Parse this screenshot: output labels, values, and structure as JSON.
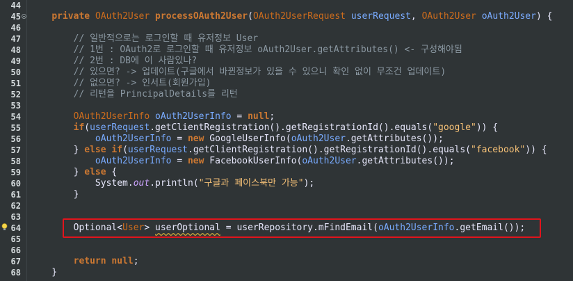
{
  "editor": {
    "lines": [
      {
        "num": "44",
        "tokens": []
      },
      {
        "num": "45",
        "tokens": [
          {
            "t": "    ",
            "c": "pl"
          },
          {
            "t": "private",
            "c": "kw"
          },
          {
            "t": " ",
            "c": "pl"
          },
          {
            "t": "OAuth2User",
            "c": "kw2"
          },
          {
            "t": " ",
            "c": "pl"
          },
          {
            "t": "processOAuth2User",
            "c": "kw"
          },
          {
            "t": "(",
            "c": "pl"
          },
          {
            "t": "OAuth2UserRequest",
            "c": "kw2"
          },
          {
            "t": " ",
            "c": "pl"
          },
          {
            "t": "userRequest",
            "c": "var"
          },
          {
            "t": ", ",
            "c": "pl"
          },
          {
            "t": "OAuth2User",
            "c": "kw2"
          },
          {
            "t": " ",
            "c": "pl"
          },
          {
            "t": "oAuth2User",
            "c": "var"
          },
          {
            "t": ") {",
            "c": "pl"
          }
        ]
      },
      {
        "num": "46",
        "tokens": []
      },
      {
        "num": "47",
        "tokens": [
          {
            "t": "        // 일반적으로는 로그인할 때 유저정보 User",
            "c": "cm"
          }
        ]
      },
      {
        "num": "48",
        "tokens": [
          {
            "t": "        // 1번 : OAuth2로 로그인할 때 유저정보 oAuth2User.getAttributes() <- 구성해야됨",
            "c": "cm"
          }
        ]
      },
      {
        "num": "49",
        "tokens": [
          {
            "t": "        // 2번 : DB에 이 사람있나?",
            "c": "cm"
          }
        ]
      },
      {
        "num": "50",
        "tokens": [
          {
            "t": "        // 있으면? -> 업데이트(구글에서 바뀐정보가 있을 수 있으니 확인 없이 무조건 업데이트)",
            "c": "cm"
          }
        ]
      },
      {
        "num": "51",
        "tokens": [
          {
            "t": "        // 없으면? -> 인서트(회원가입)",
            "c": "cm"
          }
        ]
      },
      {
        "num": "52",
        "tokens": [
          {
            "t": "        // 리턴을 PrincipalDetails를 리턴",
            "c": "cm"
          }
        ]
      },
      {
        "num": "53",
        "tokens": []
      },
      {
        "num": "54",
        "tokens": [
          {
            "t": "        ",
            "c": "pl"
          },
          {
            "t": "OAuth2UserInfo",
            "c": "kw2"
          },
          {
            "t": " ",
            "c": "pl"
          },
          {
            "t": "oAuth2UserInfo",
            "c": "var"
          },
          {
            "t": " = ",
            "c": "pl"
          },
          {
            "t": "null",
            "c": "kw"
          },
          {
            "t": ";",
            "c": "pl"
          }
        ]
      },
      {
        "num": "55",
        "tokens": [
          {
            "t": "        ",
            "c": "pl"
          },
          {
            "t": "if",
            "c": "kw"
          },
          {
            "t": "(",
            "c": "pl"
          },
          {
            "t": "userRequest",
            "c": "var"
          },
          {
            "t": ".getClientRegistration().getRegistrationId().equals(",
            "c": "pl"
          },
          {
            "t": "\"google\"",
            "c": "str"
          },
          {
            "t": ")) {",
            "c": "pl"
          }
        ]
      },
      {
        "num": "56",
        "tokens": [
          {
            "t": "            ",
            "c": "pl"
          },
          {
            "t": "oAuth2UserInfo",
            "c": "var"
          },
          {
            "t": " = ",
            "c": "pl"
          },
          {
            "t": "new",
            "c": "kw"
          },
          {
            "t": " GoogleUserInfo(",
            "c": "pl"
          },
          {
            "t": "oAuth2User",
            "c": "var"
          },
          {
            "t": ".getAttributes());",
            "c": "pl"
          }
        ]
      },
      {
        "num": "57",
        "tokens": [
          {
            "t": "        } ",
            "c": "pl"
          },
          {
            "t": "else",
            "c": "kw"
          },
          {
            "t": " ",
            "c": "pl"
          },
          {
            "t": "if",
            "c": "kw"
          },
          {
            "t": "(",
            "c": "pl"
          },
          {
            "t": "userRequest",
            "c": "var"
          },
          {
            "t": ".getClientRegistration().getRegistrationId().equals(",
            "c": "pl"
          },
          {
            "t": "\"facebook\"",
            "c": "str"
          },
          {
            "t": ")) {",
            "c": "pl"
          }
        ]
      },
      {
        "num": "58",
        "tokens": [
          {
            "t": "            ",
            "c": "pl"
          },
          {
            "t": "oAuth2UserInfo",
            "c": "var"
          },
          {
            "t": " = ",
            "c": "pl"
          },
          {
            "t": "new",
            "c": "kw"
          },
          {
            "t": " FacebookUserInfo(",
            "c": "pl"
          },
          {
            "t": "oAuth2User",
            "c": "var"
          },
          {
            "t": ".getAttributes());",
            "c": "pl"
          }
        ]
      },
      {
        "num": "59",
        "tokens": [
          {
            "t": "        } ",
            "c": "pl"
          },
          {
            "t": "else",
            "c": "kw"
          },
          {
            "t": " {",
            "c": "pl"
          }
        ]
      },
      {
        "num": "60",
        "tokens": [
          {
            "t": "            System.",
            "c": "pl"
          },
          {
            "t": "out",
            "c": "st"
          },
          {
            "t": ".println(",
            "c": "pl"
          },
          {
            "t": "\"구글과 페이스북만 가능\"",
            "c": "str"
          },
          {
            "t": ");",
            "c": "pl"
          }
        ]
      },
      {
        "num": "61",
        "tokens": [
          {
            "t": "        }",
            "c": "pl"
          }
        ]
      },
      {
        "num": "62",
        "tokens": []
      },
      {
        "num": "63",
        "tokens": []
      },
      {
        "num": "64",
        "tokens": [
          {
            "t": "        Optional<",
            "c": "pl"
          },
          {
            "t": "User",
            "c": "kw2"
          },
          {
            "t": "> ",
            "c": "pl"
          },
          {
            "t": "userOptional",
            "c": "pl",
            "squiggle": true
          },
          {
            "t": " = ",
            "c": "pl"
          },
          {
            "t": "userRepository",
            "c": "pl"
          },
          {
            "t": ".mFindEmail(",
            "c": "pl"
          },
          {
            "t": "oAuth2UserInfo",
            "c": "var"
          },
          {
            "t": ".getEmail());",
            "c": "pl"
          }
        ]
      },
      {
        "num": "65",
        "tokens": []
      },
      {
        "num": "66",
        "tokens": []
      },
      {
        "num": "67",
        "tokens": [
          {
            "t": "        ",
            "c": "pl"
          },
          {
            "t": "return",
            "c": "kw"
          },
          {
            "t": " ",
            "c": "pl"
          },
          {
            "t": "null",
            "c": "kw"
          },
          {
            "t": ";",
            "c": "pl"
          }
        ]
      },
      {
        "num": "68",
        "tokens": [
          {
            "t": "    }",
            "c": "pl"
          }
        ]
      }
    ],
    "fold_line": "45",
    "warning_line": "64",
    "highlight_line": "64",
    "colors": {
      "background": "#2f3436",
      "keyword": "#cc7832",
      "variable": "#79abff",
      "comment": "#8a97a1",
      "string": "#f6c177",
      "highlight_border": "#e2141c"
    }
  }
}
